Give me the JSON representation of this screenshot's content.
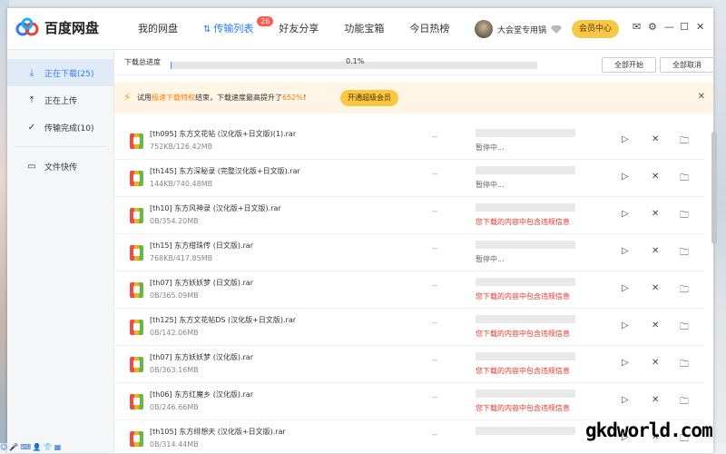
{
  "app": {
    "name": "百度网盘"
  },
  "nav": [
    {
      "label": "我的网盘"
    },
    {
      "label": "传输列表",
      "badge": "26"
    },
    {
      "label": "好友分享"
    },
    {
      "label": "功能宝箱"
    },
    {
      "label": "今日热榜"
    }
  ],
  "user": {
    "name": "大会堂专用锅",
    "vip_label": "会员中心"
  },
  "sidebar": {
    "items": [
      {
        "label": "正在下载(25)"
      },
      {
        "label": "正在上传"
      },
      {
        "label": "传输完成(10)"
      },
      {
        "label": "文件快传"
      }
    ]
  },
  "progress": {
    "label": "下载总进度",
    "percent_text": "0.1%",
    "value": 0.001
  },
  "buttons": {
    "start_all": "全部开始",
    "cancel_all": "全部取消"
  },
  "promo": {
    "text_a": "试用",
    "highlight_a": "极速下载特权",
    "text_b": "结束，下载速度最高提升了",
    "highlight_b": "652%",
    "text_c": "！",
    "button": "开通超级会员"
  },
  "downloads": [
    {
      "name": "[th095] 东方文花帖 (汉化版+日文版)(1).rar",
      "size": "752KB/126.42MB",
      "speed": "--",
      "status": "暂停中...",
      "error": false
    },
    {
      "name": "[th145] 东方深秘录 (完整汉化版+日文版).rar",
      "size": "144KB/740.48MB",
      "speed": "--",
      "status": "暂停中...",
      "error": false
    },
    {
      "name": "[th10] 东方风神录 (汉化版+日文版).rar",
      "size": "0B/354.20MB",
      "speed": "--",
      "status": "您下载的内容中包含违规信息",
      "error": true
    },
    {
      "name": "[th15] 东方绀珠传 (日文版).rar",
      "size": "768KB/417.85MB",
      "speed": "--",
      "status": "暂停中...",
      "error": false
    },
    {
      "name": "[th07] 东方妖妖梦 (日文版).rar",
      "size": "0B/365.09MB",
      "speed": "--",
      "status": "您下载的内容中包含违规信息",
      "error": true
    },
    {
      "name": "[th125] 东方文花帖DS (汉化版+日文版).rar",
      "size": "0B/142.06MB",
      "speed": "--",
      "status": "您下载的内容中包含违规信息",
      "error": true
    },
    {
      "name": "[th07] 东方妖妖梦 (汉化版).rar",
      "size": "0B/363.16MB",
      "speed": "--",
      "status": "您下载的内容中包含违规信息",
      "error": true
    },
    {
      "name": "[th06] 东方红魔乡 (汉化版).rar",
      "size": "0B/246.66MB",
      "speed": "--",
      "status": "您下载的内容中包含违规信息",
      "error": true
    },
    {
      "name": "[th105] 东方绯想天 (汉化版+日文版).rar",
      "size": "0B/314.44MB",
      "speed": "--",
      "status": "",
      "error": false
    }
  ],
  "watermark": "gkdworld.com",
  "colors": {
    "accent": "#2b7cf2",
    "error": "#e3352b",
    "vip": "#f7c84a",
    "promo_bg": "#fff5e5"
  }
}
